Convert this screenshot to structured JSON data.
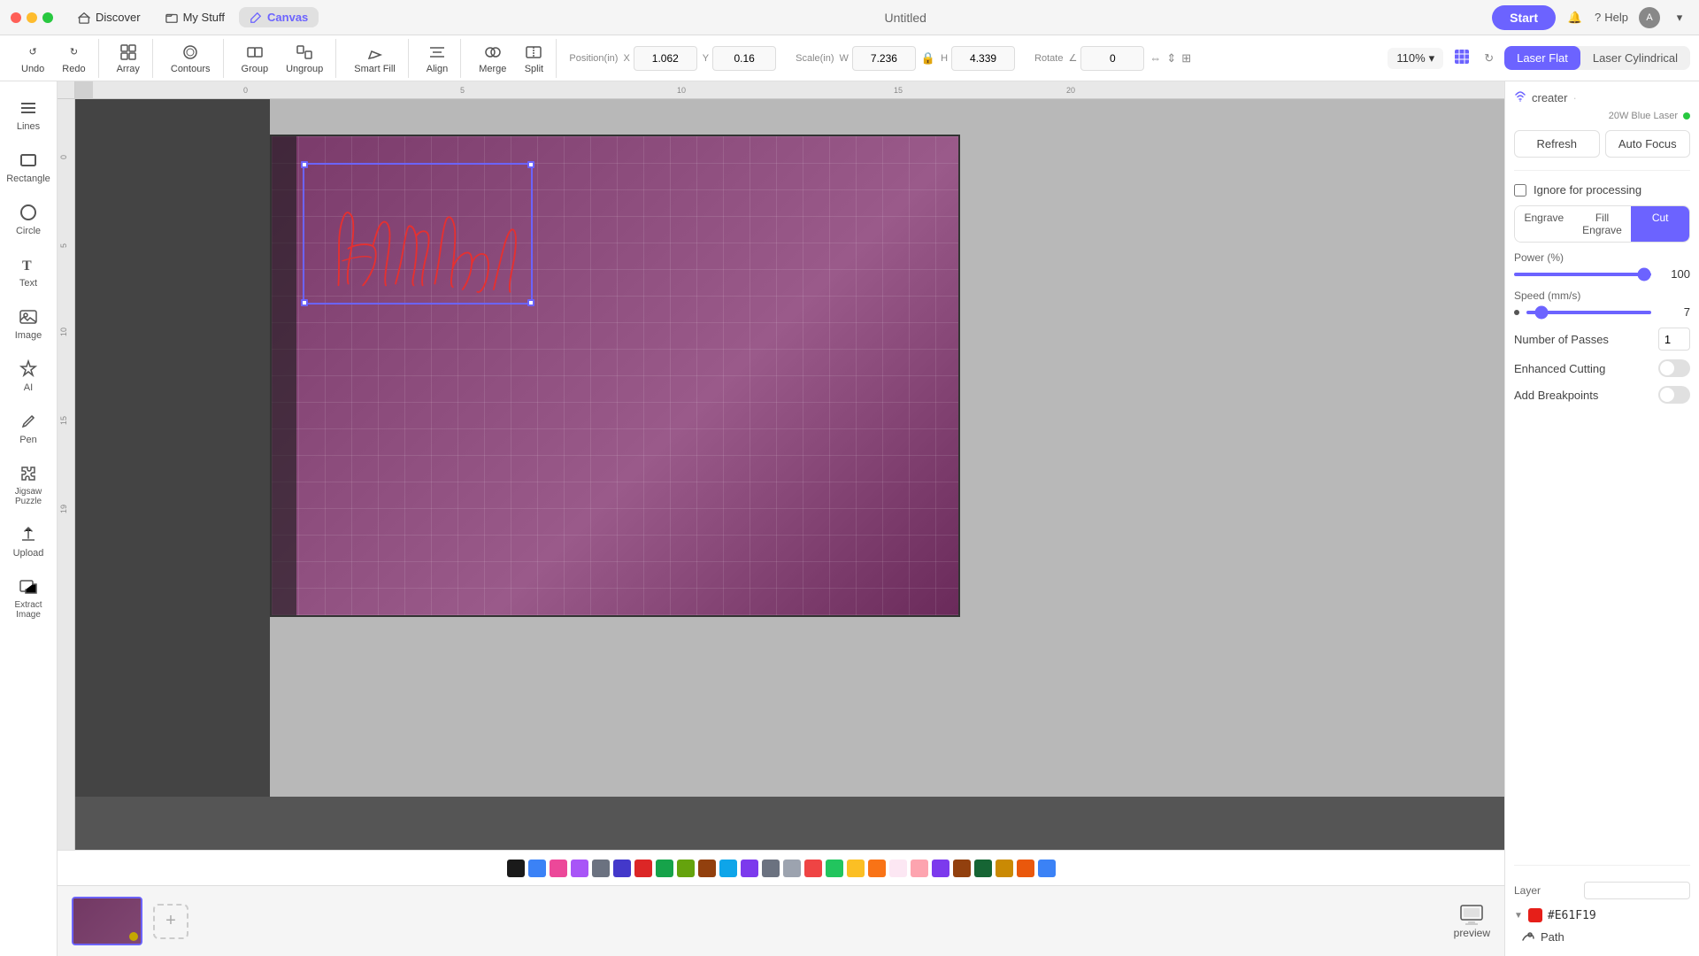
{
  "app": {
    "title": "Untitled",
    "tabs": [
      {
        "label": "Discover",
        "icon": "home"
      },
      {
        "label": "My Stuff",
        "icon": "folder"
      },
      {
        "label": "Canvas",
        "icon": "pencil",
        "active": true
      }
    ]
  },
  "toolbar": {
    "undo_label": "Undo",
    "redo_label": "Redo",
    "array_label": "Array",
    "contours_label": "Contours",
    "group_label": "Group",
    "ungroup_label": "Ungroup",
    "smart_fill_label": "Smart Fill",
    "align_label": "Align",
    "merge_label": "Merge",
    "split_label": "Split",
    "zoom": "110%",
    "position_label": "Position(in)",
    "x_val": "1.062",
    "y_val": "0.16",
    "scale_label": "Scale(in)",
    "w_val": "7.236",
    "h_val": "4.339",
    "rotate_label": "Rotate",
    "r_val": "0",
    "start_label": "Start"
  },
  "laser": {
    "flat_label": "Laser Flat",
    "cylindrical_label": "Laser Cylindrical"
  },
  "tools": [
    {
      "name": "lines",
      "label": "Lines",
      "icon": "lines"
    },
    {
      "name": "rectangle",
      "label": "Rectangle",
      "icon": "rectangle"
    },
    {
      "name": "circle",
      "label": "Circle",
      "icon": "circle"
    },
    {
      "name": "text",
      "label": "Text",
      "icon": "text"
    },
    {
      "name": "image",
      "label": "Image",
      "icon": "image"
    },
    {
      "name": "ai",
      "label": "AI",
      "icon": "ai"
    },
    {
      "name": "pen",
      "label": "Pen",
      "icon": "pen"
    },
    {
      "name": "jigsaw",
      "label": "Jigsaw Puzzle",
      "icon": "jigsaw"
    },
    {
      "name": "upload",
      "label": "Upload",
      "icon": "upload"
    },
    {
      "name": "extract",
      "label": "Extract Image",
      "icon": "extract"
    }
  ],
  "right_panel": {
    "device_name": "creater",
    "device_dot": "·",
    "device_power": "20W Blue Laser",
    "refresh_label": "Refresh",
    "auto_focus_label": "Auto Focus",
    "ignore_label": "Ignore for processing",
    "process_tabs": [
      "Engrave",
      "Fill Engrave",
      "Cut"
    ],
    "active_tab": "Cut",
    "power_label": "Power (%)",
    "power_val": "100",
    "speed_label": "Speed (mm/s)",
    "speed_val": "7",
    "passes_label": "Number of Passes",
    "passes_val": "1",
    "enhanced_label": "Enhanced Cutting",
    "breakpoints_label": "Add Breakpoints",
    "layer_label": "Layer",
    "layer_color": "#E61F19",
    "layer_color_hex": "#E61F19",
    "path_label": "Path"
  },
  "colors": [
    "#1a1a1a",
    "#3b82f6",
    "#ec4899",
    "#a855f7",
    "#6b7280",
    "#4338ca",
    "#dc2626",
    "#16a34a",
    "#65a30d",
    "#92400e",
    "#0ea5e9",
    "#7c3aed",
    "#6b7280",
    "#9ca3af",
    "#ef4444",
    "#22c55e",
    "#fbbf24",
    "#f97316",
    "#fce7f3",
    "#fda4af",
    "#7c3aed",
    "#92400e",
    "#166534",
    "#ca8a04",
    "#ea580c",
    "#3b82f6"
  ],
  "bottom": {
    "preview_label": "preview",
    "add_page": "+"
  }
}
